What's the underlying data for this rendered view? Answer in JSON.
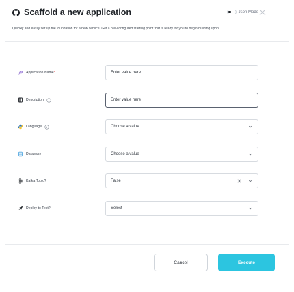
{
  "header": {
    "title": "Scaffold a new application",
    "json_mode_label": "Json Mode"
  },
  "description": "Quickly and easily set up the foundation for a new service. Get a pre-configured starting point that is ready for you to begin building upon.",
  "form": {
    "application_name": {
      "label": "Application Name",
      "required_mark": "*",
      "placeholder": "Enter value here"
    },
    "description": {
      "label": "Description",
      "placeholder": "Enter value here"
    },
    "language": {
      "label": "Language",
      "value": "Choose a value"
    },
    "database": {
      "label": "Database",
      "value": "Choose a value"
    },
    "kafka_topic": {
      "label": "Kafka Topic?",
      "value": "False"
    },
    "deploy_to_test": {
      "label": "Deploy to Test?",
      "value": "Select"
    }
  },
  "actions": {
    "cancel_label": "Cancel",
    "execute_label": "Execute"
  },
  "colors": {
    "accent": "#2cc5e0",
    "required": "#e5484d"
  },
  "icons": {
    "header": "github-icon",
    "close": "close-icon",
    "application_name": "rocket-icon",
    "description": "book-icon",
    "language": "python-icon",
    "database": "database-icon",
    "kafka_topic": "kafka-icon",
    "deploy_to_test": "deploy-icon"
  }
}
